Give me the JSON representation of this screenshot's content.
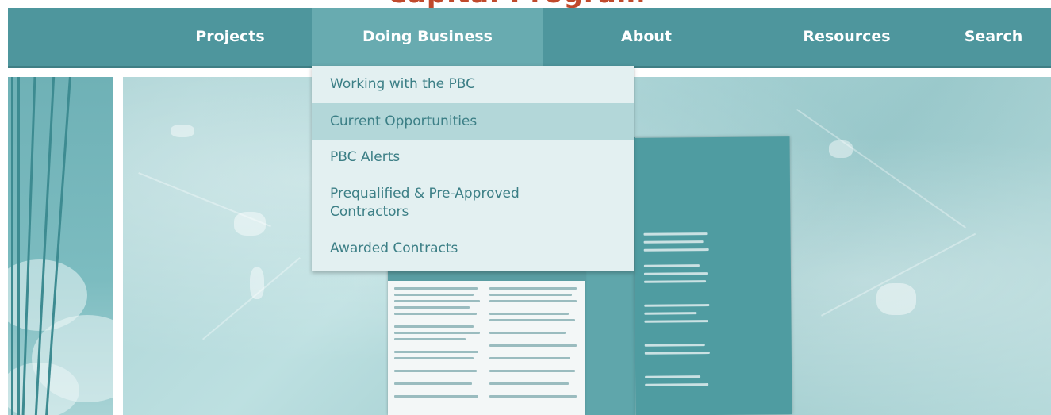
{
  "header": {
    "title_fragment": "Capital Program",
    "title_color": "#c0492b"
  },
  "nav": {
    "items": [
      {
        "label": "Projects"
      },
      {
        "label": "Doing Business",
        "active": true
      },
      {
        "label": "About"
      },
      {
        "label": "Resources"
      },
      {
        "label": "Search"
      }
    ],
    "background": "#4e969d",
    "active_background": "#68abb0"
  },
  "dropdown": {
    "parent": "Doing Business",
    "items": [
      {
        "label": "Working with the PBC"
      },
      {
        "label": "Current Opportunities",
        "highlighted": true
      },
      {
        "label": "PBC Alerts"
      },
      {
        "label": "Prequalified & Pre-Approved Contractors"
      },
      {
        "label": "Awarded Contracts"
      }
    ],
    "background": "#e3f0f1",
    "highlight_background": "#b3d7d9",
    "text_color": "#3c7f86"
  },
  "hero": {
    "image": "teal-tinted-brochure-photo"
  }
}
